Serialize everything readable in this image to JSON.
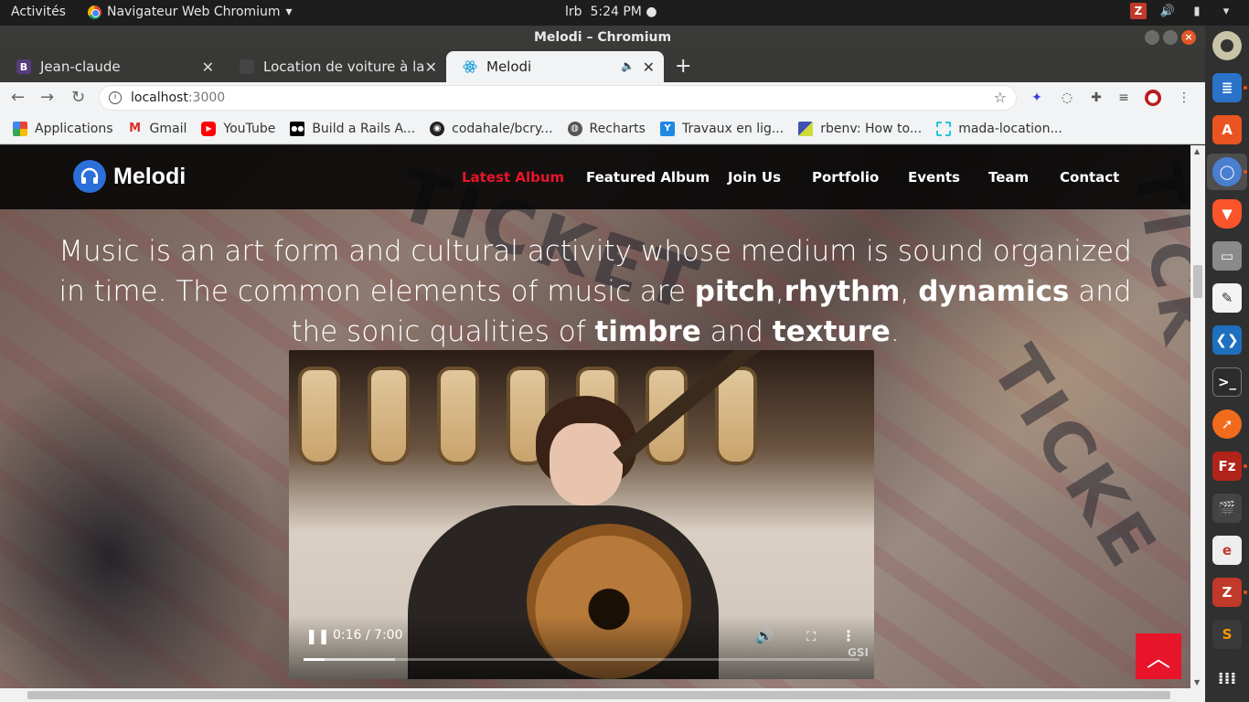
{
  "system": {
    "activities": "Activités",
    "app_menu": "Navigateur Web Chromium",
    "clock_user": "lrb",
    "clock_time": "5:24 PM"
  },
  "window": {
    "title": "Melodi – Chromium"
  },
  "tabs": [
    {
      "label": "Jean-claude",
      "favicon": "B",
      "favicon_color": "#563d7c"
    },
    {
      "label": "Location de voiture à la Ré",
      "favicon": "",
      "favicon_color": "#444444"
    },
    {
      "label": "Melodi",
      "favicon": "react-icon",
      "favicon_color": "#61dafb"
    }
  ],
  "address_bar": {
    "host": "localhost",
    "port": ":3000"
  },
  "bookmarks": [
    {
      "label": "Applications",
      "icon": "apps-grid-icon"
    },
    {
      "label": "Gmail",
      "icon": "gmail-icon"
    },
    {
      "label": "YouTube",
      "icon": "youtube-icon"
    },
    {
      "label": "Build a Rails A...",
      "icon": "dev-icon"
    },
    {
      "label": "codahale/bcry...",
      "icon": "github-icon"
    },
    {
      "label": "Recharts",
      "icon": "globe-icon"
    },
    {
      "label": "Travaux en lig...",
      "icon": "travaux-icon"
    },
    {
      "label": "rbenv: How to...",
      "icon": "rbenv-icon"
    },
    {
      "label": "mada-location...",
      "icon": "mada-icon"
    }
  ],
  "site": {
    "brand": "Melodi",
    "nav": [
      {
        "label": "Latest Album",
        "active": true
      },
      {
        "label": "Featured Album",
        "active": false
      },
      {
        "label": "Join Us",
        "active": false
      },
      {
        "label": "Portfolio",
        "active": false
      },
      {
        "label": "Events",
        "active": false
      },
      {
        "label": "Team",
        "active": false
      },
      {
        "label": "Contact",
        "active": false
      }
    ],
    "hero": {
      "text_1": "Music is an art form and cultural activity whose medium is sound organized in time. The common elements of music are ",
      "bold_1": "pitch",
      "sep_1": ",",
      "bold_2": "rhythm",
      "sep_2": ", ",
      "bold_3": "dynamics",
      "text_2": " and the sonic qualities of ",
      "bold_4": "timbre",
      "text_3": " and ",
      "bold_5": "texture",
      "text_4": "."
    },
    "video": {
      "time": "0:16 / 7:00",
      "played_fraction": 0.038,
      "buffered_fraction": 0.165,
      "watermark": "GSI"
    }
  },
  "colors": {
    "accent": "#e8142a",
    "nav_bg": "#050505",
    "brand_logo": "#2d6fd8"
  }
}
